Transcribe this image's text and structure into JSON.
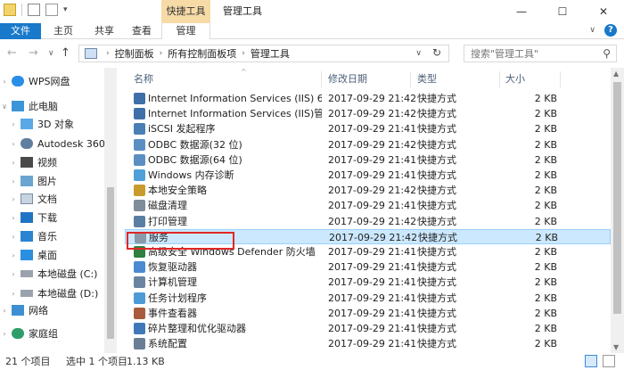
{
  "titlebar": {
    "context_tab": "快捷工具",
    "title": "管理工具",
    "minimize": "—",
    "maximize": "☐",
    "close": "✕"
  },
  "ribbon": {
    "tabs": [
      "文件",
      "主页",
      "共享",
      "查看",
      "管理"
    ],
    "file_color": "#1979ca"
  },
  "address": {
    "crumbs": [
      "控制面板",
      "所有控制面板项",
      "管理工具"
    ],
    "search_placeholder": "搜索\"管理工具\""
  },
  "nav": {
    "items": [
      {
        "label": "WPS网盘",
        "icon": "cloud-icon"
      },
      {
        "label": "此电脑",
        "icon": "computer-icon"
      },
      {
        "label": "3D 对象",
        "icon": "cube-icon"
      },
      {
        "label": "Autodesk 360",
        "icon": "cloud-icon"
      },
      {
        "label": "视频",
        "icon": "video-icon"
      },
      {
        "label": "图片",
        "icon": "picture-icon"
      },
      {
        "label": "文档",
        "icon": "document-icon"
      },
      {
        "label": "下载",
        "icon": "download-icon"
      },
      {
        "label": "音乐",
        "icon": "music-icon"
      },
      {
        "label": "桌面",
        "icon": "desktop-icon"
      },
      {
        "label": "本地磁盘 (C:)",
        "icon": "drive-icon"
      },
      {
        "label": "本地磁盘 (D:)",
        "icon": "drive-icon"
      },
      {
        "label": "网络",
        "icon": "network-icon"
      },
      {
        "label": "家庭组",
        "icon": "homegroup-icon"
      }
    ]
  },
  "columns": {
    "name": "名称",
    "date": "修改日期",
    "type": "类型",
    "size": "大小"
  },
  "files": [
    {
      "name": "Internet Information Services (IIS) 6.0...",
      "date": "2017-09-29 21:42",
      "type": "快捷方式",
      "size": "2 KB"
    },
    {
      "name": "Internet Information Services (IIS)管...",
      "date": "2017-09-29 21:42",
      "type": "快捷方式",
      "size": "2 KB"
    },
    {
      "name": "iSCSI 发起程序",
      "date": "2017-09-29 21:41",
      "type": "快捷方式",
      "size": "2 KB"
    },
    {
      "name": "ODBC 数据源(32 位)",
      "date": "2017-09-29 21:42",
      "type": "快捷方式",
      "size": "2 KB"
    },
    {
      "name": "ODBC 数据源(64 位)",
      "date": "2017-09-29 21:41",
      "type": "快捷方式",
      "size": "2 KB"
    },
    {
      "name": "Windows 内存诊断",
      "date": "2017-09-29 21:41",
      "type": "快捷方式",
      "size": "2 KB"
    },
    {
      "name": "本地安全策略",
      "date": "2017-09-29 21:42",
      "type": "快捷方式",
      "size": "2 KB"
    },
    {
      "name": "磁盘清理",
      "date": "2017-09-29 21:41",
      "type": "快捷方式",
      "size": "2 KB"
    },
    {
      "name": "打印管理",
      "date": "2017-09-29 21:42",
      "type": "快捷方式",
      "size": "2 KB"
    },
    {
      "name": "服务",
      "date": "2017-09-29 21:42",
      "type": "快捷方式",
      "size": "2 KB"
    },
    {
      "name": "高级安全 Windows Defender 防火墙",
      "date": "2017-09-29 21:41",
      "type": "快捷方式",
      "size": "2 KB"
    },
    {
      "name": "恢复驱动器",
      "date": "2017-09-29 21:41",
      "type": "快捷方式",
      "size": "2 KB"
    },
    {
      "name": "计算机管理",
      "date": "2017-09-29 21:41",
      "type": "快捷方式",
      "size": "2 KB"
    },
    {
      "name": "任务计划程序",
      "date": "2017-09-29 21:41",
      "type": "快捷方式",
      "size": "2 KB"
    },
    {
      "name": "事件查看器",
      "date": "2017-09-29 21:41",
      "type": "快捷方式",
      "size": "2 KB"
    },
    {
      "name": "碎片整理和优化驱动器",
      "date": "2017-09-29 21:41",
      "type": "快捷方式",
      "size": "2 KB"
    },
    {
      "name": "系统配置",
      "date": "2017-09-29 21:41",
      "type": "快捷方式",
      "size": "2 KB"
    }
  ],
  "selected_index": 9,
  "status": {
    "count": "21 个项目",
    "selected": "选中 1 个项目",
    "size": "1.13 KB"
  },
  "colors": {
    "selection_bg": "#cce8ff",
    "highlight_box": "#e02727",
    "context_tab": "#f7dba7"
  }
}
